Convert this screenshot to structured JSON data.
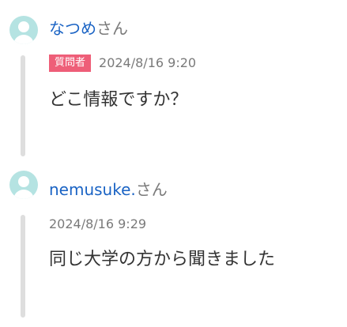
{
  "posts": [
    {
      "username": "なつめ",
      "honorific": "さん",
      "badge": "質問者",
      "timestamp": "2024/8/16 9:20",
      "message": "どこ情報ですか？",
      "avatar_color": "#b5e3e2"
    },
    {
      "username": "nemusuke.",
      "honorific": "さん",
      "timestamp": "2024/8/16 9:29",
      "message": "同じ大学の方から聞きました",
      "avatar_color": "#b5e3e2"
    }
  ],
  "colors": {
    "username": "#1a63c4",
    "badge_bg": "#ee5e78",
    "thread_line": "#dedede",
    "muted_text": "#7a7a7a"
  },
  "icons": {
    "avatar": "default-user-avatar-icon"
  }
}
